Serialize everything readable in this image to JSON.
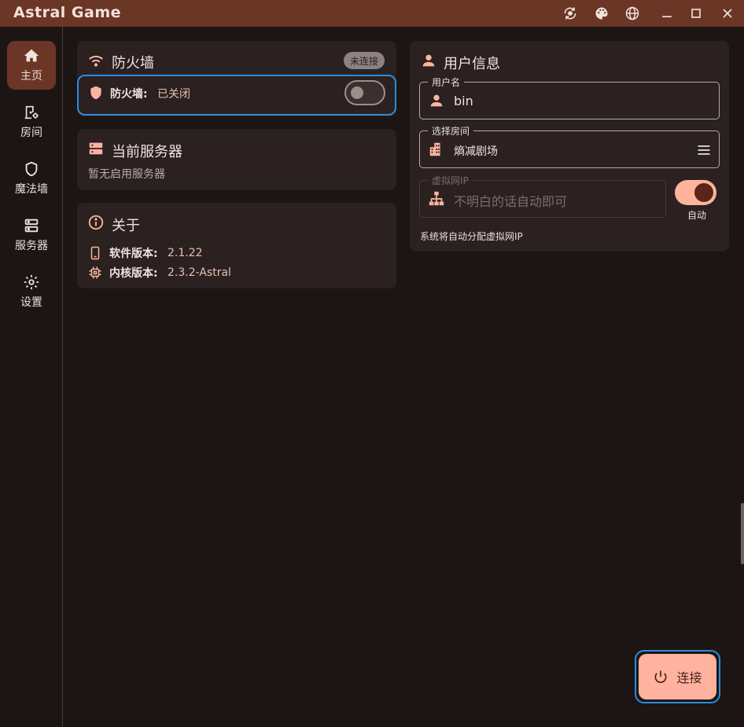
{
  "app": {
    "title": "Astral Game"
  },
  "titlebar": {
    "icons": [
      "sync-icon",
      "palette-icon",
      "globe-icon",
      "minimize-icon",
      "maximize-icon",
      "close-icon"
    ]
  },
  "sidebar": {
    "items": [
      {
        "label": "主页",
        "icon": "home-icon",
        "active": true
      },
      {
        "label": "房间",
        "icon": "room-settings-icon",
        "active": false
      },
      {
        "label": "魔法墙",
        "icon": "shield-icon",
        "active": false
      },
      {
        "label": "服务器",
        "icon": "server-icon",
        "active": false
      },
      {
        "label": "设置",
        "icon": "gear-icon",
        "active": false
      }
    ]
  },
  "firewall": {
    "title": "防火墙",
    "badge": "未连接",
    "label": "防火墙:",
    "status": "已关闭"
  },
  "server": {
    "title": "当前服务器",
    "subtitle": "暂无启用服务器"
  },
  "about": {
    "title": "关于",
    "software_label": "软件版本:",
    "software_version": "2.1.22",
    "core_label": "内核版本:",
    "core_version": "2.3.2-Astral"
  },
  "user": {
    "title": "用户信息",
    "username_label": "用户名",
    "username_value": "bin",
    "room_label": "选择房间",
    "room_value": "熵减剧场",
    "ip_label": "虚拟网IP",
    "ip_placeholder": "不明白的话自动即可",
    "auto_label": "自动",
    "hint": "系统将自动分配虚拟网IP"
  },
  "connect": {
    "label": "连接"
  },
  "colors": {
    "accent": "#ffb39e",
    "titlebar": "#6b3626",
    "card": "#2a2120",
    "background": "#1c1514",
    "focus": "#2b8be0"
  }
}
